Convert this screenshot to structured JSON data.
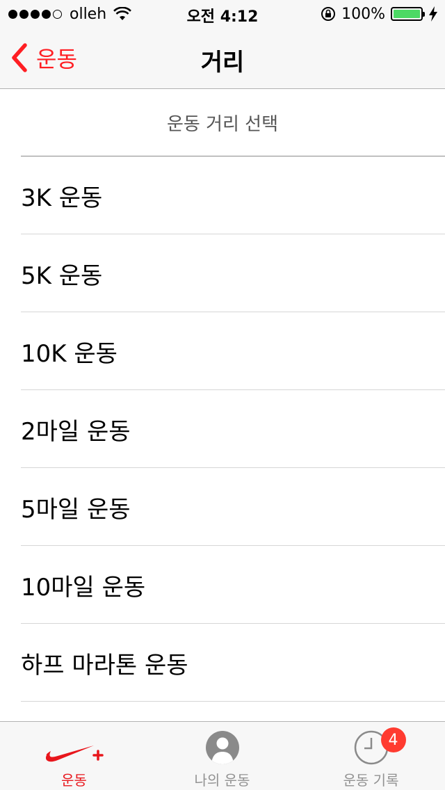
{
  "status_bar": {
    "carrier": "olleh",
    "time": "오전 4:12",
    "battery": "100%"
  },
  "nav": {
    "back_label": "운동",
    "title": "거리"
  },
  "content": {
    "section_header": "운동 거리 선택",
    "items": [
      {
        "label": "3K 운동"
      },
      {
        "label": "5K 운동"
      },
      {
        "label": "10K 운동"
      },
      {
        "label": "2마일 운동"
      },
      {
        "label": "5마일 운동"
      },
      {
        "label": "10마일 운동"
      },
      {
        "label": "하프 마라톤 운동"
      }
    ]
  },
  "tab_bar": {
    "tabs": [
      {
        "label": "운동",
        "icon": "nike-plus-icon",
        "active": true
      },
      {
        "label": "나의 운동",
        "icon": "profile-icon",
        "active": false
      },
      {
        "label": "운동 기록",
        "icon": "clock-icon",
        "active": false,
        "badge": "4"
      }
    ]
  },
  "colors": {
    "accent": "#ff1e23",
    "battery_fill": "#4cd964",
    "badge": "#ff3b30",
    "inactive": "#929292"
  }
}
